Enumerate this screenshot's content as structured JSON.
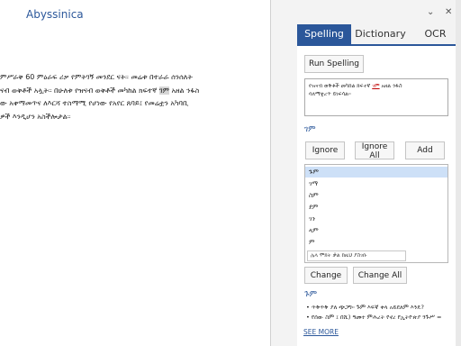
{
  "document": {
    "lines": [
      "ምሥራቅ 60 ምዕራፍ ሪቃ የምትገኝ መንደር ናት። መሬቱ በተራራ ሰንሰለት",
      "ናብ ወቅቶች አሏት። በሁለቱ የዝናብ ወቅቶች መካከል ክፍተኛ ገም አዘል ንፋስ",
      "ው አቀማመጥና ለእርሻ ተስማሚ የሆነው የአየር ጸባይ፤ የመሬቷን አካባቢ",
      "ዎች እንዲሆን አስችሎታል።"
    ],
    "highlight_word": "ገም"
  },
  "pane": {
    "title": "Abyssinica",
    "dropdown_icon": "⌄",
    "close_icon": "✕",
    "tabs": [
      {
        "label": "Spelling",
        "active": true
      },
      {
        "label": "Dictionary",
        "active": false
      },
      {
        "label": "OCR",
        "active": false
      }
    ],
    "run_button": "Run Spelling",
    "context": {
      "before": "የዝናብ ወቅቶች መካከል ክፍተኛ ",
      "error": "ገም",
      "after": " አዘል ንፋስ",
      "line2": "ባለማቋረጥ ይነፍሳል።"
    },
    "selected_word": "ገም",
    "buttons": {
      "ignore": "Ignore",
      "ignore_all": "Ignore All",
      "add": "Add",
      "change": "Change",
      "change_all": "Change All"
    },
    "suggestions": [
      "ጉም",
      "ገማ",
      "ስም",
      "ደም",
      "ገን",
      "ላም",
      "ም"
    ],
    "suggestion_input_placeholder": "ሌላ ሞክት ቃል ከዚህ ያስገቡ",
    "definition": {
      "word": "ጉም",
      "lines": [
        "• ጥቅጥቅ ያለ ጭጋግ። ጉም እፍኛ ቀላ አይደለም እንዴ?",
        "• የሰው ስም ፤ በሺ) ዓመተ ምሕረት የኖረ የኢትዮጵያ ንጉሥ ="
      ]
    },
    "see_more": "SEE MORE"
  },
  "colors": {
    "accent": "#2b579a",
    "error": "#c00000",
    "selection": "#cde0f7"
  }
}
